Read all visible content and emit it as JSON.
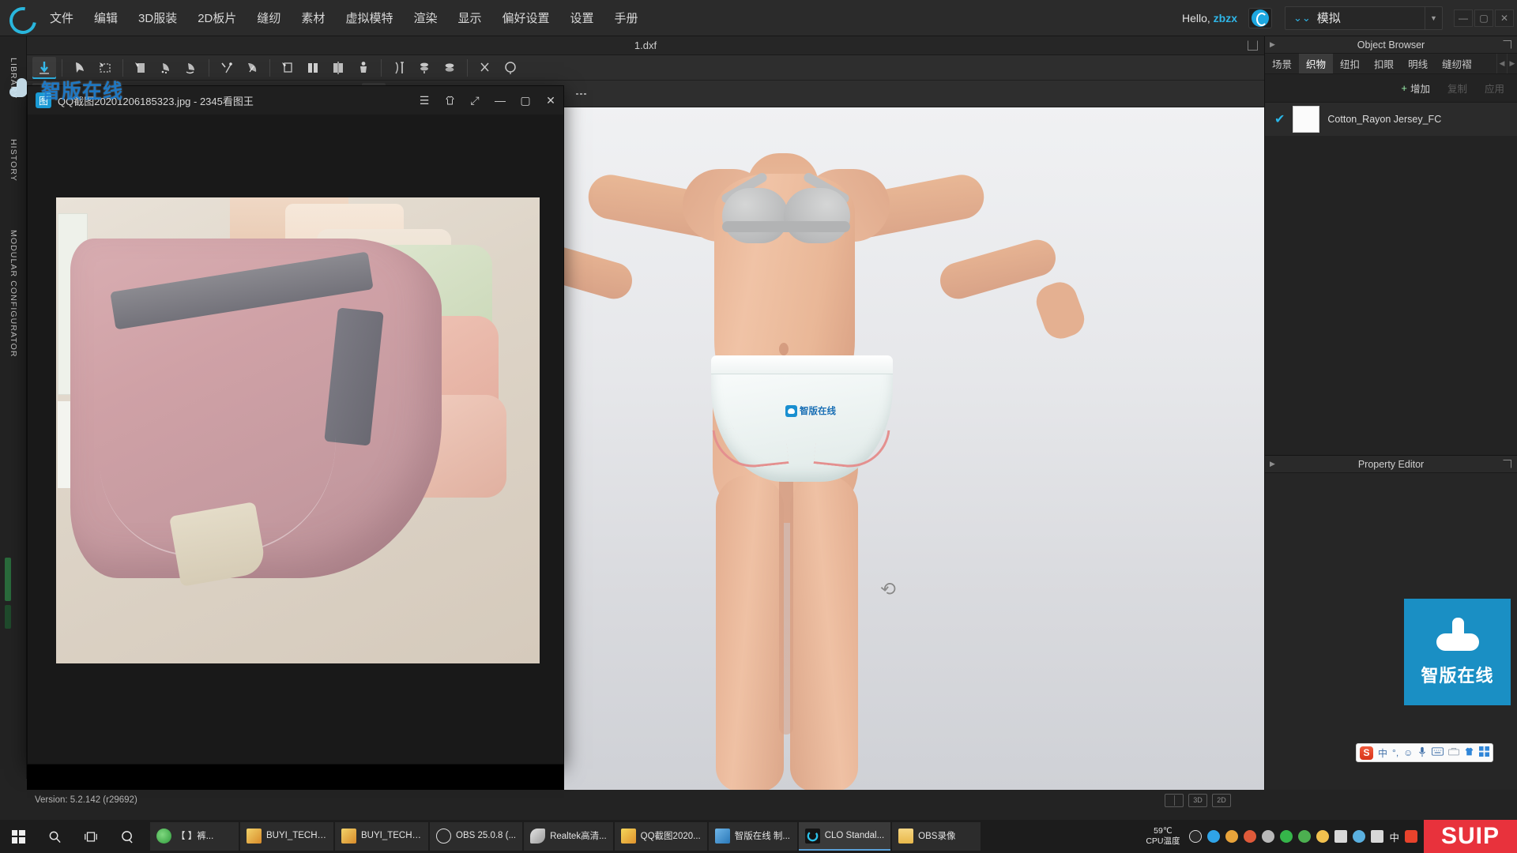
{
  "app": {
    "logo_icon": "clo-c-logo-icon",
    "version_status": "Version: 5.2.142 (r29692)",
    "document_tab": "1.dxf"
  },
  "menubar": {
    "items": [
      {
        "label": "文件"
      },
      {
        "label": "编辑"
      },
      {
        "label": "3D服装"
      },
      {
        "label": "2D板片"
      },
      {
        "label": "缝纫"
      },
      {
        "label": "素材"
      },
      {
        "label": "虚拟模特"
      },
      {
        "label": "渲染"
      },
      {
        "label": "显示"
      },
      {
        "label": "偏好设置"
      },
      {
        "label": "设置"
      },
      {
        "label": "手册"
      }
    ],
    "greeting_prefix": "Hello, ",
    "greeting_user": "zbzx",
    "cloud_button_icon": "cloud-account-icon",
    "mode_value": "模拟",
    "window_minimize": "—",
    "window_maximize": "▢",
    "window_close": "✕"
  },
  "left_rail": {
    "items": [
      {
        "label": "LIBRARY"
      },
      {
        "label": "HISTORY"
      },
      {
        "label": "MODULAR CONFIGURATOR"
      }
    ]
  },
  "toolbar_rows": [
    {
      "groups": [
        {
          "buttons": [
            {
              "icon": "simulate-arrow-icon",
              "active": true
            }
          ]
        },
        {
          "buttons": [
            {
              "icon": "select-mesh-icon"
            },
            {
              "icon": "box-select-icon"
            }
          ]
        },
        {
          "buttons": [
            {
              "icon": "pin-icon"
            },
            {
              "icon": "fold-arrange-icon"
            },
            {
              "icon": "unfold-icon"
            }
          ]
        },
        {
          "buttons": [
            {
              "icon": "segment-sew-icon"
            },
            {
              "icon": "free-sew-icon"
            }
          ]
        },
        {
          "buttons": [
            {
              "icon": "trim-icon"
            },
            {
              "icon": "garment-front-icon"
            },
            {
              "icon": "garment-symmetry-icon"
            },
            {
              "icon": "avatar-icon"
            }
          ]
        },
        {
          "buttons": [
            {
              "icon": "measure-tape-icon"
            },
            {
              "icon": "gravity-icon"
            },
            {
              "icon": "layer-icon"
            }
          ]
        },
        {
          "buttons": [
            {
              "icon": "scissor-icon"
            },
            {
              "icon": "balloon-icon"
            }
          ]
        }
      ]
    },
    {
      "groups": [
        {
          "buttons": [
            {
              "icon": "transform-pattern-icon"
            },
            {
              "icon": "edit-pattern-icon"
            }
          ]
        },
        {
          "buttons": [
            {
              "icon": "edit-curve-icon"
            },
            {
              "icon": "add-point-icon"
            }
          ]
        },
        {
          "buttons": [
            {
              "icon": "polygon-icon"
            },
            {
              "icon": "rectangle-icon"
            },
            {
              "icon": "circle-icon"
            }
          ]
        },
        {
          "buttons": [
            {
              "icon": "internal-line-icon"
            },
            {
              "icon": "dart-icon"
            }
          ]
        },
        {
          "buttons": [
            {
              "icon": "pleat-icon"
            },
            {
              "icon": "fold-icon"
            }
          ]
        },
        {
          "buttons": [
            {
              "icon": "sew-line-icon"
            },
            {
              "icon": "free-sew-line-icon"
            }
          ]
        },
        {
          "buttons": [
            {
              "icon": "texture-icon"
            },
            {
              "icon": "graphic-icon"
            }
          ]
        },
        {
          "buttons": [
            {
              "icon": "button-icon"
            },
            {
              "icon": "buttonhole-icon"
            }
          ]
        },
        {
          "buttons": [
            {
              "icon": "zipper-icon"
            },
            {
              "icon": "topstitch-icon"
            }
          ]
        }
      ]
    }
  ],
  "image_viewer": {
    "app_icon": "picture-viewer-icon",
    "title": "QQ截图20201206185323.jpg - 2345看图王",
    "controls": [
      {
        "icon": "hamburger-menu-icon",
        "glyph": "☰"
      },
      {
        "icon": "shirt-icon",
        "glyph": "♕"
      },
      {
        "icon": "fullscreen-icon",
        "glyph": "⤢"
      },
      {
        "icon": "minimize-icon",
        "glyph": "—"
      },
      {
        "icon": "maximize-icon",
        "glyph": "▢"
      },
      {
        "icon": "close-icon",
        "glyph": "✕"
      }
    ]
  },
  "object_browser": {
    "title": "Object Browser",
    "collapse_icon": "chevron-right-icon",
    "popout_icon": "popout-icon",
    "tabs": [
      {
        "label": "场景",
        "active": false
      },
      {
        "label": "织物",
        "active": true
      },
      {
        "label": "纽扣",
        "active": false
      },
      {
        "label": "扣眼",
        "active": false
      },
      {
        "label": "明线",
        "active": false
      },
      {
        "label": "缝纫褶",
        "active": false
      }
    ],
    "tab_prev": "◀",
    "tab_next": "▶",
    "actions": [
      {
        "label": "增加",
        "plus": "+",
        "disabled": false
      },
      {
        "label": "复制",
        "plus": "",
        "disabled": true
      },
      {
        "label": "应用",
        "plus": "",
        "disabled": true
      }
    ],
    "rows": [
      {
        "checked": "✔",
        "swatch_color": "#fbfbfb",
        "name": "Cotton_Rayon Jersey_FC"
      }
    ]
  },
  "property_editor": {
    "title": "Property Editor",
    "collapse_icon": "chevron-right-icon",
    "popout_icon": "popout-icon"
  },
  "viewport": {
    "cursor_icon": "rotate-cursor-icon",
    "toggles": [
      {
        "label": "",
        "icon": "split-view-icon"
      },
      {
        "label": "3D",
        "icon": "view-3d-icon"
      },
      {
        "label": "2D",
        "icon": "view-2d-icon"
      }
    ],
    "garment_logo_text": "智版在线"
  },
  "watermarks": {
    "left_text": "智版在线",
    "badge_text": "智版在线",
    "badge_color": "#1a8fc4",
    "left_color": "#1f7fd0"
  },
  "ime_bar": {
    "brand": "S",
    "items": [
      {
        "label": "中",
        "icon": "chinese-mode-icon"
      },
      {
        "label": "°,",
        "icon": "punctuation-icon"
      },
      {
        "label": "☺",
        "icon": "emoji-icon"
      },
      {
        "label": "🎤",
        "icon": "voice-input-icon"
      },
      {
        "label": "⌨",
        "icon": "soft-keyboard-icon"
      },
      {
        "label": "▤",
        "icon": "toolbox-icon"
      },
      {
        "label": "👕",
        "icon": "skin-icon"
      },
      {
        "label": "▦",
        "icon": "apps-icon"
      }
    ]
  },
  "taskbar": {
    "system_buttons": [
      {
        "icon": "windows-start-icon"
      },
      {
        "icon": "search-icon",
        "glyph": "◯"
      },
      {
        "icon": "task-view-icon",
        "glyph": "❐"
      },
      {
        "icon": "cortana-icon",
        "glyph": "◎"
      }
    ],
    "apps": [
      {
        "label": "【          】裤...",
        "icon_color": "#4caf50",
        "icon": "edge-browser-icon",
        "active": false
      },
      {
        "label": "BUYI_TECHN...",
        "icon_color": "#f2c14e",
        "icon": "image-file-icon",
        "active": false
      },
      {
        "label": "BUYI_TECHN...",
        "icon_color": "#f2c14e",
        "icon": "image-file-icon",
        "active": false
      },
      {
        "label": "OBS 25.0.8 (...",
        "icon_color": "#2b2b2b",
        "icon": "obs-icon",
        "active": false
      },
      {
        "label": "Realtek高清...",
        "icon_color": "#cfcfcf",
        "icon": "realtek-audio-icon",
        "active": false
      },
      {
        "label": "QQ截图2020...",
        "icon_color": "#e8c04a",
        "icon": "qq-screenshot-icon",
        "active": false
      },
      {
        "label": "智版在线 制...",
        "icon_color": "#3f8fd0",
        "icon": "zhiban-icon",
        "active": false
      },
      {
        "label": "CLO Standal...",
        "icon_color": "#1b1b1b",
        "icon": "clo-icon",
        "active": true
      },
      {
        "label": "OBS录像",
        "icon_color": "#f3cf6a",
        "icon": "folder-icon",
        "active": false
      }
    ],
    "cpu_temp_value": "59℃",
    "cpu_temp_label": "CPU温度",
    "tray_icons": [
      {
        "icon": "obs-tray-icon",
        "color": "#d04a4a"
      },
      {
        "icon": "media-player-tray-icon",
        "color": "#2fa4e8"
      },
      {
        "icon": "penguin-tray-icon",
        "color": "#e8a33a"
      },
      {
        "icon": "flame-tray-icon",
        "color": "#e05a3a"
      },
      {
        "icon": "audio-tray-icon",
        "color": "#b9b9b9"
      },
      {
        "icon": "shield-tray-icon",
        "color": "#35b54a"
      },
      {
        "icon": "browser-tray-icon",
        "color": "#4caf50"
      },
      {
        "icon": "update-tray-icon",
        "color": "#f2c14e"
      },
      {
        "icon": "wifi-tray-icon",
        "color": "#d8d8d8"
      },
      {
        "icon": "person-tray-icon",
        "color": "#5ab0e0"
      },
      {
        "icon": "volume-tray-icon",
        "color": "#d8d8d8"
      }
    ],
    "tray_text": "中",
    "tray_sogou": "S",
    "suip_label": "SUIP"
  }
}
